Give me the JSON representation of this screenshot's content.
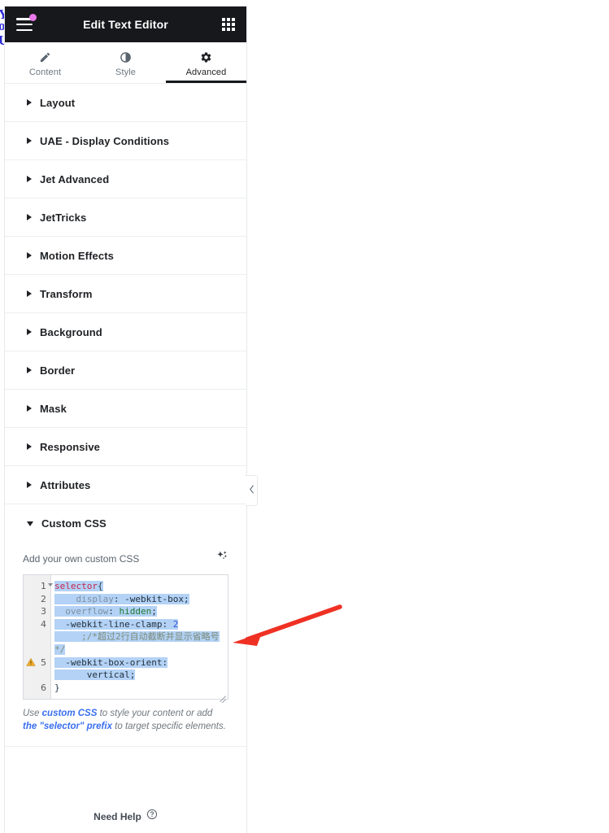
{
  "panel": {
    "title": "Edit Text Editor",
    "menu_icon": "hamburger-menu-icon",
    "apps_icon": "grid-apps-icon"
  },
  "tabs": [
    {
      "label": "Content",
      "icon": "pencil-icon",
      "active": false
    },
    {
      "label": "Style",
      "icon": "half-circle-icon",
      "active": false
    },
    {
      "label": "Advanced",
      "icon": "gear-icon",
      "active": true
    }
  ],
  "sections": [
    {
      "label": "Layout",
      "expanded": false
    },
    {
      "label": "UAE - Display Conditions",
      "expanded": false
    },
    {
      "label": "Jet Advanced",
      "expanded": false
    },
    {
      "label": "JetTricks",
      "expanded": false
    },
    {
      "label": "Motion Effects",
      "expanded": false
    },
    {
      "label": "Transform",
      "expanded": false
    },
    {
      "label": "Background",
      "expanded": false
    },
    {
      "label": "Border",
      "expanded": false
    },
    {
      "label": "Mask",
      "expanded": false
    },
    {
      "label": "Responsive",
      "expanded": false
    },
    {
      "label": "Attributes",
      "expanded": false
    },
    {
      "label": "Custom CSS",
      "expanded": true
    }
  ],
  "custom_css": {
    "field_label": "Add your own custom CSS",
    "ai_icon": "ai-sparkle-icon",
    "line_numbers": [
      "1",
      "2",
      "3",
      "4",
      "5",
      "6"
    ],
    "warning_line": "5",
    "fold_line": "1",
    "code_lines": [
      "selector{",
      "    display: -webkit-box;",
      "  overflow: hidden;",
      "  -webkit-line-clamp: 2",
      "     ;/*超过2行自动截断并显示省略号*/",
      "  -webkit-box-orient: vertical;",
      "}"
    ],
    "code_tokens": {
      "selector": "selector",
      "open_brace": "{",
      "display_prop": "display",
      "display_value": "-webkit-box;",
      "overflow_prop": "overflow",
      "overflow_value": "hidden",
      "semicolon": ";",
      "clamp_prop": "-webkit-line-clamp:",
      "clamp_value": "2",
      "comment": ";/*超过2行自动截断并显示省略号*/",
      "orient_prop": "-webkit-box-orient:",
      "orient_value": "vertical;",
      "close_brace": "}"
    },
    "hint": {
      "part1": "Use ",
      "link1": "custom CSS",
      "part2": " to style your content or add ",
      "link2": "the \"selector\" prefix",
      "part3": " to target specific elements."
    }
  },
  "footer": {
    "need_help": "Need Help",
    "help_icon": "question-mark-circle-icon"
  },
  "collapse": {
    "icon": "chevron-left-icon"
  },
  "annotation": {
    "icon": "red-arrow-pointing-left"
  },
  "colors": {
    "header_bg": "#16181c",
    "accent_dot": "#e879e8",
    "link_blue": "#3a6ff0",
    "selection": "#b3d2f5",
    "arrow_red": "#ef3124",
    "warning_amber": "#f0ad2e"
  }
}
